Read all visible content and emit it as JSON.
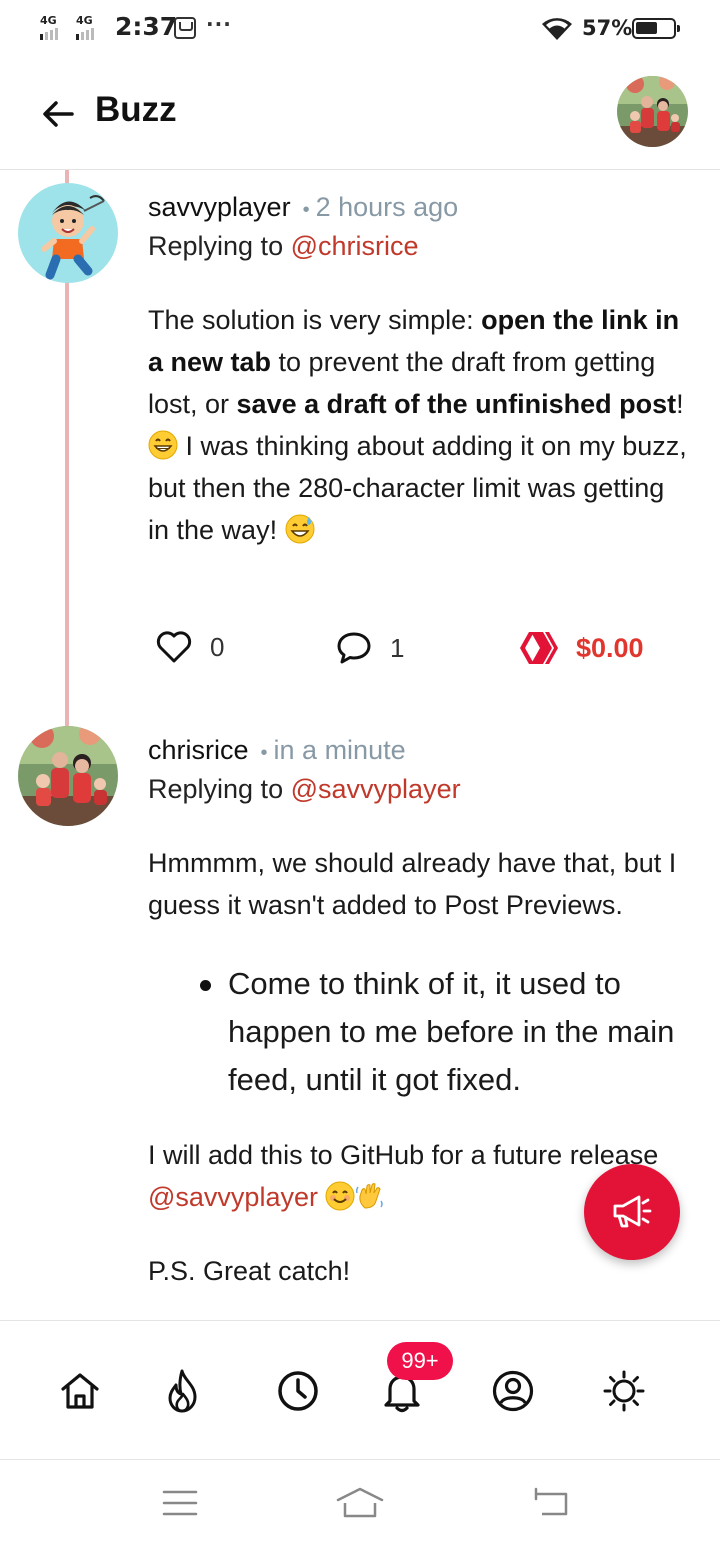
{
  "status_bar": {
    "network_1": "4G",
    "network_2": "4G",
    "time": "2:37",
    "battery_percent": "57%",
    "battery_level": 0.57
  },
  "header": {
    "title": "Buzz",
    "back_icon": "arrow-left-icon",
    "avatar_icon": "user-avatar"
  },
  "posts": [
    {
      "author": "savvyplayer",
      "separator": "•",
      "time": "2 hours ago",
      "replying_prefix": "Replying to",
      "replying_to": "@chrisrice",
      "body": {
        "t1": "The solution is very simple: ",
        "b1": "open the link in a new tab",
        "t2": " to prevent the draft from getting lost, or ",
        "b2": "save a draft of the unfinished post",
        "t3": "!",
        "t4": " I was thinking about adding it on my buzz, but then the 280-character limit was getting in the way! "
      },
      "likes": "0",
      "comments": "1",
      "payout": "$0.00"
    },
    {
      "author": "chrisrice",
      "separator": "•",
      "time": "in a minute",
      "replying_prefix": "Replying to",
      "replying_to": "@savvyplayer",
      "para1": "Hmmmm, we should already have that, but I guess it wasn't added to Post Previews.",
      "bullet1": "Come to think of it, it used to happen to me before in the main feed, until it got fixed.",
      "para2": "I will add this to GitHub for a future release",
      "para2_mention": "@savvyplayer",
      "ps_label": "P.S.",
      "ps_text": " Great catch!"
    }
  ],
  "fab": {
    "icon": "megaphone-icon"
  },
  "bottom_nav": {
    "items": [
      "home-icon",
      "fire-icon",
      "clock-icon",
      "bell-icon",
      "profile-icon",
      "settings-icon"
    ],
    "notification_badge": "99+"
  },
  "colors": {
    "accent": "#e31337",
    "mention": "#c0392b",
    "thread_line": "#eab4b4",
    "badge": "#f0114a",
    "muted": "#8899a6"
  }
}
